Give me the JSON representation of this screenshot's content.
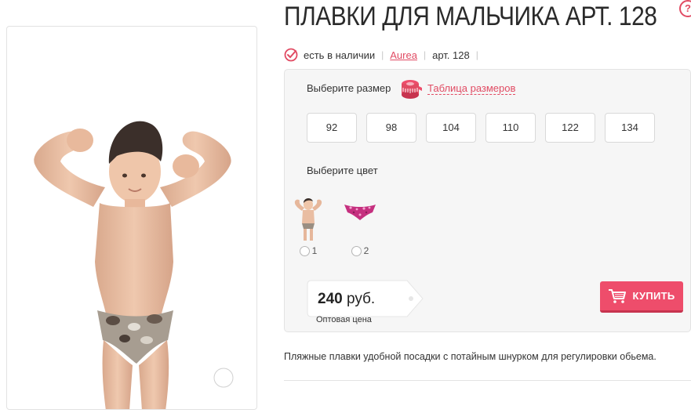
{
  "product": {
    "title": "ПЛАВКИ ДЛЯ МАЛЬЧИКА АРТ. 128",
    "availability": "есть в наличии",
    "brand": "Aurea",
    "article": "арт. 128",
    "description": "Пляжные плавки удобной посадки с потайным шнурком для регулировки обьема."
  },
  "icons": {
    "corner": "help-icon",
    "availability": "check-circle-icon",
    "size_table": "measuring-tape-icon",
    "zoom": "magnifier-icon",
    "cart": "cart-icon"
  },
  "size_select": {
    "label": "Выберите размер",
    "table_link": "Таблица размеров",
    "sizes": [
      "92",
      "98",
      "104",
      "110",
      "122",
      "134"
    ]
  },
  "color_select": {
    "label": "Выберите цвет",
    "options": [
      "1",
      "2"
    ]
  },
  "price": {
    "value": "240",
    "currency": "руб.",
    "note": "Оптовая цена"
  },
  "buy_button": {
    "label": "КУПИТЬ"
  },
  "colors": {
    "accent": "#e14b63",
    "buy_button": "#ee4d6b",
    "panel_bg": "#f6f6f6"
  }
}
